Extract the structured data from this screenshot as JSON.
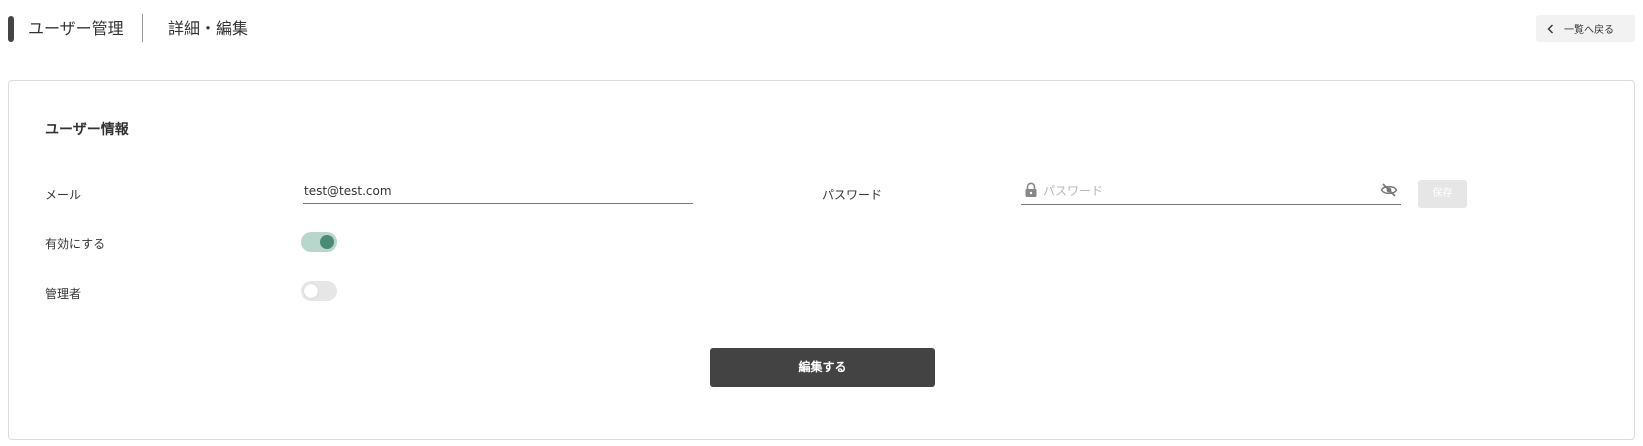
{
  "header": {
    "title": "ユーザー管理",
    "subtitle": "詳細・編集",
    "back_label": "一覧へ戻る"
  },
  "user_info": {
    "section_title": "ユーザー情報",
    "email": {
      "label": "メール",
      "value": "test@test.com"
    },
    "password": {
      "label": "パスワード",
      "placeholder": "パスワード",
      "save_label": "保存"
    },
    "enabled": {
      "label": "有効にする",
      "checked": true
    },
    "admin": {
      "label": "管理者",
      "checked": false
    },
    "edit_label": "編集する"
  },
  "icons": {
    "back": "chevron-left-icon",
    "lock": "lock-icon",
    "visibility": "eye-off-icon"
  },
  "colors": {
    "accent_dark": "#434343",
    "toggle_on_track": "#b9d6cc",
    "toggle_on_knob": "#4a8a76",
    "disabled_button": "#e6e6e6"
  }
}
